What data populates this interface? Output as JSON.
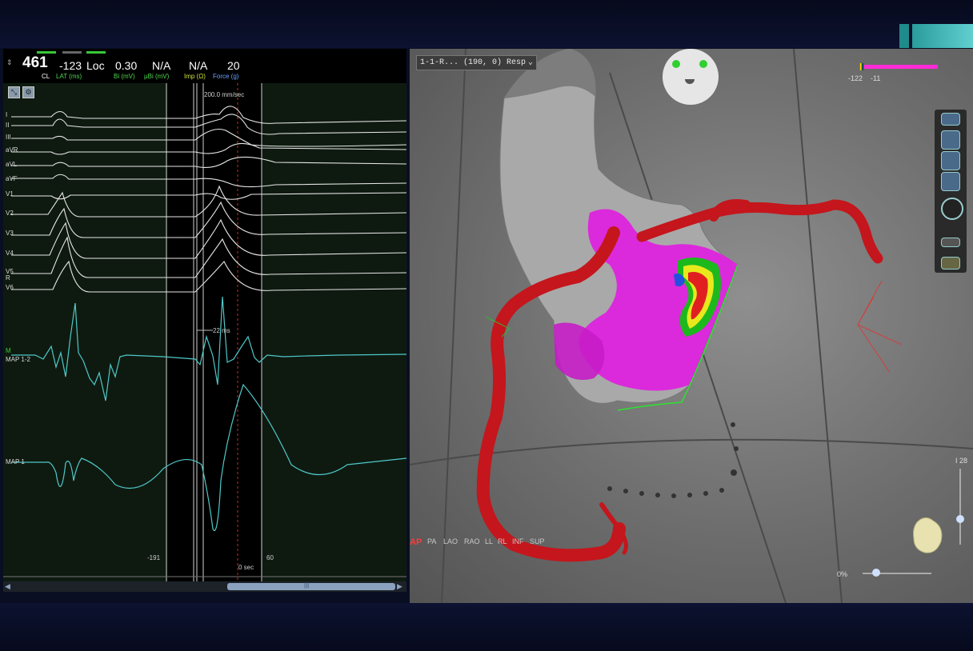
{
  "ep_panel": {
    "header": {
      "cl_value": "461",
      "cl_label": "CL",
      "lat_value": "-123",
      "lat_label": "LAT (ms)",
      "loc_label": "Loc",
      "bi_value": "0.30",
      "bi_label": "Bi (mV)",
      "ubi_value": "N/A",
      "ubi_label": "µBi (mV)",
      "imp_value": "N/A",
      "imp_label": "Imp (Ω)",
      "force_value": "20",
      "force_label": "Force (g)"
    },
    "sweep_speed": "200.0 mm/sec",
    "interval_label": "22 ms",
    "marker_left": "-191",
    "marker_center": "0 sec",
    "marker_right": "60",
    "leads": [
      "I",
      "II",
      "III",
      "aVR",
      "aVL",
      "aVF",
      "V1",
      "V2",
      "V3",
      "V4",
      "V5",
      "V6"
    ],
    "lead_r": "R",
    "map12_label": "MAP 1-2",
    "map1_label": "MAP 1",
    "m_label": "M",
    "scroll_center": "|||"
  },
  "map_panel": {
    "map_title": "1-1-R... (190, 0) Resp",
    "scale_low": "-122",
    "scale_high": "-11",
    "zoom_pct": "0%",
    "i_value": "I 28",
    "views": [
      "AP",
      "PA",
      "LAO",
      "RAO",
      "LL",
      "RL",
      "INF",
      "SUP"
    ],
    "active_view": "AP"
  },
  "colors": {
    "ecg_trace": "#e6e6e6",
    "map_trace": "#4fc8c8",
    "catheter": "#c4161c",
    "lat_magenta": "#e020e0",
    "accent_teal": "#2a9c9c"
  }
}
